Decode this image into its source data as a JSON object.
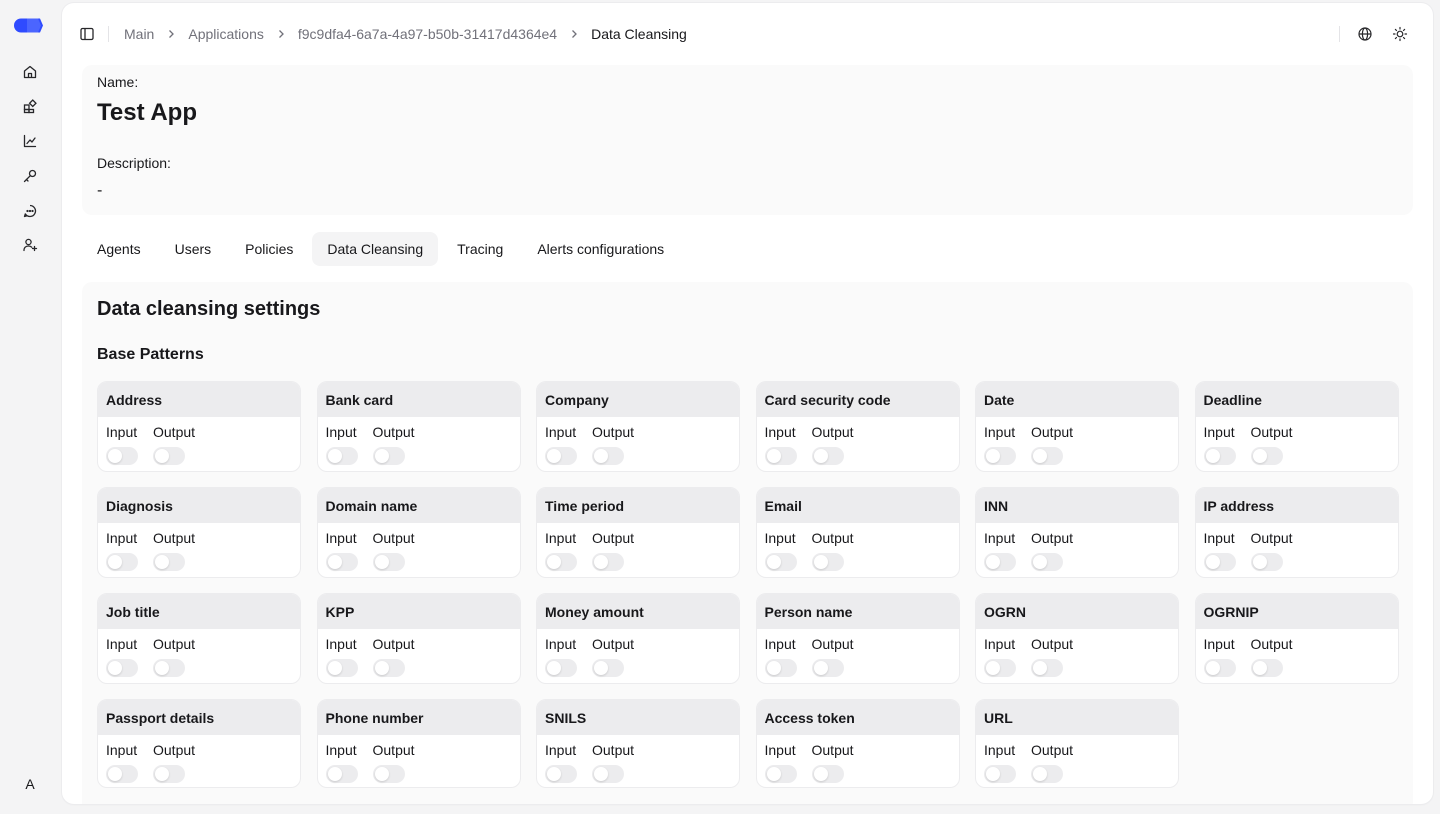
{
  "rail": {
    "items": [
      {
        "name": "home-icon"
      },
      {
        "name": "applications-icon"
      },
      {
        "name": "analytics-icon"
      },
      {
        "name": "key-icon"
      },
      {
        "name": "chat-icon"
      },
      {
        "name": "add-user-icon"
      }
    ],
    "user_initial": "A"
  },
  "breadcrumb": {
    "items": [
      "Main",
      "Applications",
      "f9c9dfa4-6a7a-4a97-b50b-31417d4364e4",
      "Data Cleansing"
    ]
  },
  "app": {
    "name_label": "Name:",
    "name": "Test App",
    "description_label": "Description:",
    "description": "-"
  },
  "tabs": [
    {
      "label": "Agents",
      "active": false
    },
    {
      "label": "Users",
      "active": false
    },
    {
      "label": "Policies",
      "active": false
    },
    {
      "label": "Data Cleansing",
      "active": true
    },
    {
      "label": "Tracing",
      "active": false
    },
    {
      "label": "Alerts configurations",
      "active": false
    }
  ],
  "settings": {
    "title": "Data cleansing settings",
    "section": "Base Patterns",
    "input_label": "Input",
    "output_label": "Output",
    "patterns": [
      {
        "name": "Address",
        "input": false,
        "output": false
      },
      {
        "name": "Bank card",
        "input": false,
        "output": false
      },
      {
        "name": "Company",
        "input": false,
        "output": false
      },
      {
        "name": "Card security code",
        "input": false,
        "output": false
      },
      {
        "name": "Date",
        "input": false,
        "output": false
      },
      {
        "name": "Deadline",
        "input": false,
        "output": false
      },
      {
        "name": "Diagnosis",
        "input": false,
        "output": false
      },
      {
        "name": "Domain name",
        "input": false,
        "output": false
      },
      {
        "name": "Time period",
        "input": false,
        "output": false
      },
      {
        "name": "Email",
        "input": false,
        "output": false
      },
      {
        "name": "INN",
        "input": false,
        "output": false
      },
      {
        "name": "IP address",
        "input": false,
        "output": false
      },
      {
        "name": "Job title",
        "input": false,
        "output": false
      },
      {
        "name": "KPP",
        "input": false,
        "output": false
      },
      {
        "name": "Money amount",
        "input": false,
        "output": false
      },
      {
        "name": "Person name",
        "input": false,
        "output": false
      },
      {
        "name": "OGRN",
        "input": false,
        "output": false
      },
      {
        "name": "OGRNIP",
        "input": false,
        "output": false
      },
      {
        "name": "Passport details",
        "input": false,
        "output": false
      },
      {
        "name": "Phone number",
        "input": false,
        "output": false
      },
      {
        "name": "SNILS",
        "input": false,
        "output": false
      },
      {
        "name": "Access token",
        "input": false,
        "output": false
      },
      {
        "name": "URL",
        "input": false,
        "output": false
      }
    ]
  },
  "colors": {
    "logo": "#2f4bff",
    "toggle_off": "#ececee",
    "card_header": "#ececee"
  }
}
